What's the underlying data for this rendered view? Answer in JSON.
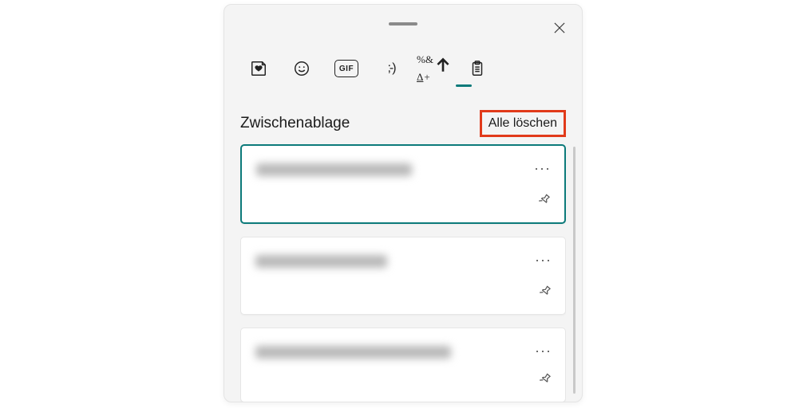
{
  "header": {
    "title": "Zwischenablage",
    "clear_all": "Alle löschen"
  },
  "tabs": {
    "gif_label": "GIF",
    "kaomoji_label": ";-)",
    "symbols_line1": "%&",
    "symbols_line2_part1": "Δ",
    "symbols_line2_part2": "+"
  },
  "items": [
    {
      "blur_width": 195,
      "more": "···",
      "selected": true
    },
    {
      "blur_width": 165,
      "more": "···",
      "selected": false
    },
    {
      "blur_width": 245,
      "more": "···",
      "selected": false
    }
  ]
}
